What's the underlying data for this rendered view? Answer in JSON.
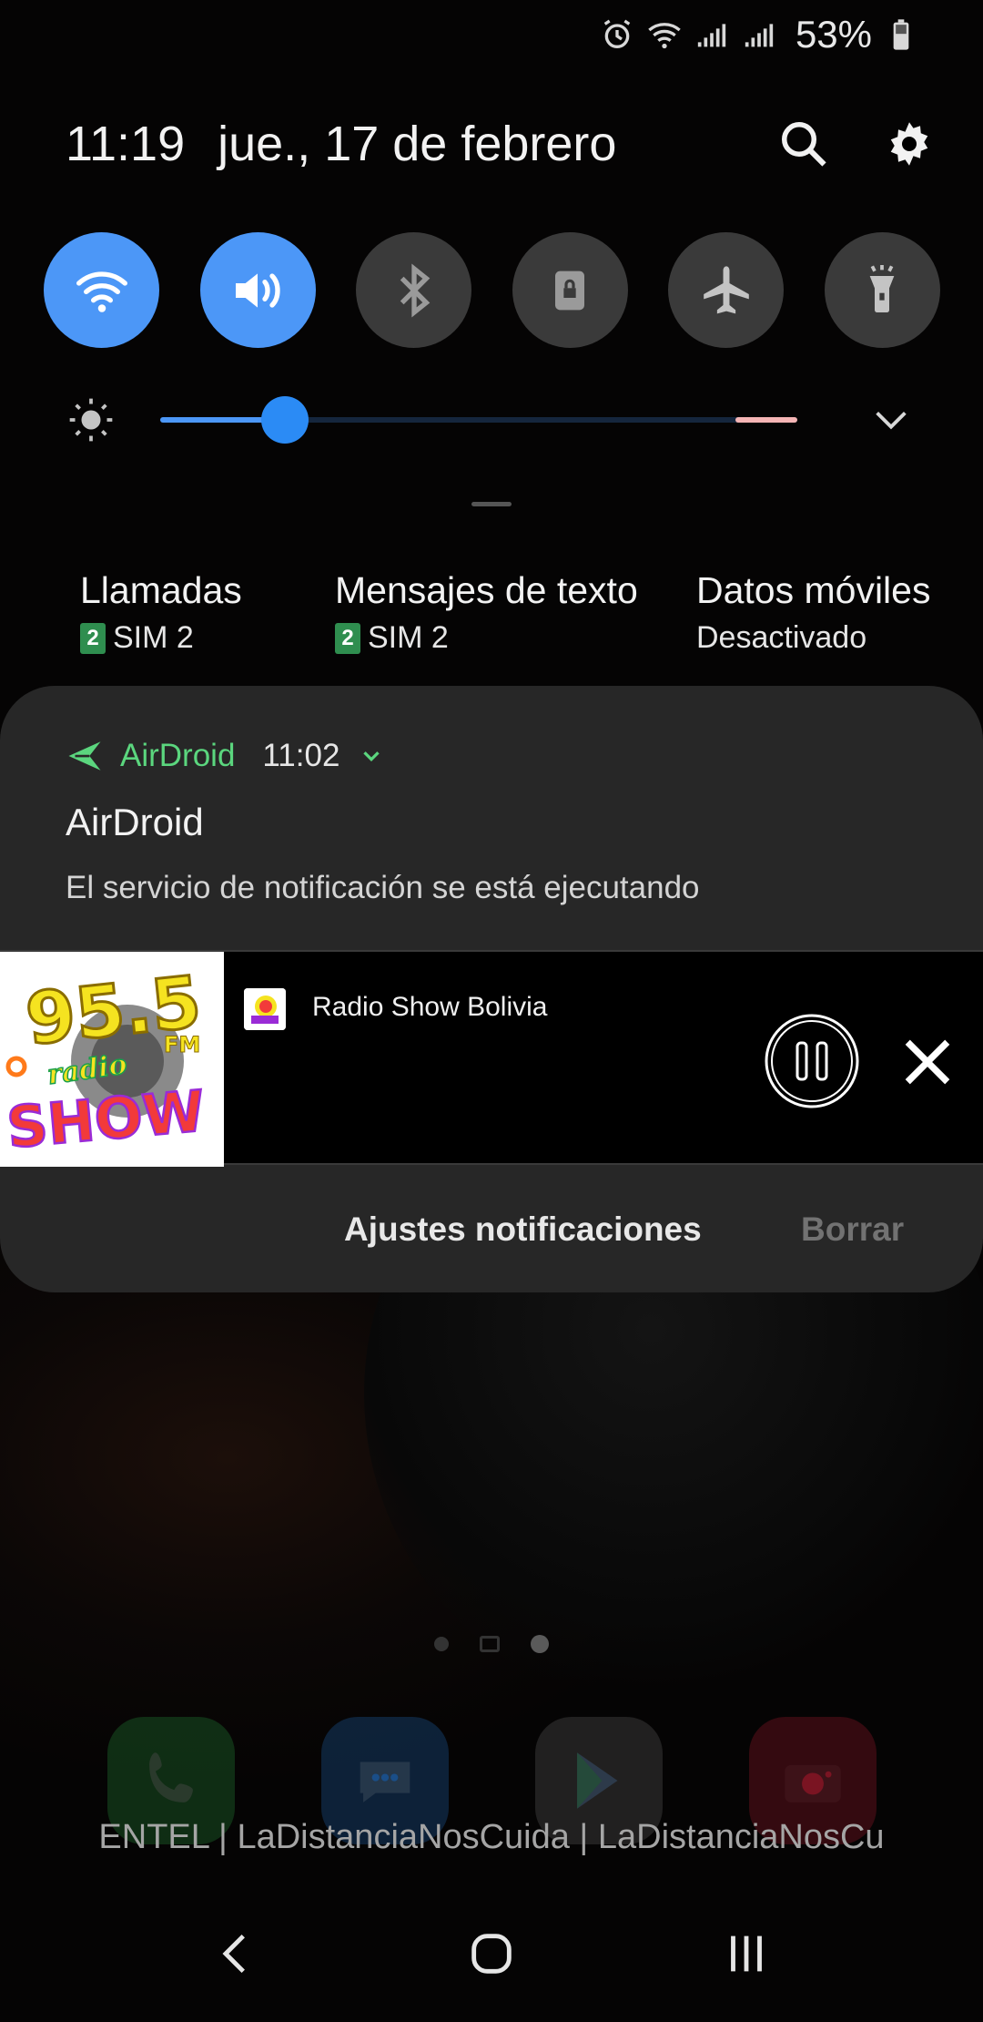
{
  "status_bar": {
    "battery_percent": "53%",
    "icons": [
      "alarm-icon",
      "wifi-icon",
      "signal-icon",
      "signal-icon",
      "battery-icon"
    ]
  },
  "header": {
    "time": "11:19",
    "date": "jue., 17 de febrero",
    "icons": [
      "search-icon",
      "gear-icon"
    ]
  },
  "quick_toggles": [
    {
      "name": "wifi-icon",
      "on": true
    },
    {
      "name": "sound-icon",
      "on": true
    },
    {
      "name": "bluetooth-icon",
      "on": false
    },
    {
      "name": "rotation-lock-icon",
      "on": false
    },
    {
      "name": "airplane-icon",
      "on": false
    },
    {
      "name": "flashlight-icon",
      "on": false
    }
  ],
  "brightness": {
    "level": 0.195,
    "colors": {
      "fill": "#4c97f7",
      "track": "#15263d",
      "warning": "#f5b5b5"
    }
  },
  "sim_info": [
    {
      "title": "Llamadas",
      "badge": "2",
      "value": "SIM 2"
    },
    {
      "title": "Mensajes de texto",
      "badge": "2",
      "value": "SIM 2"
    },
    {
      "title": "Datos móviles",
      "value": "Desactivado"
    }
  ],
  "notification": {
    "app": "AirDroid",
    "time": "11:02",
    "title": "AirDroid",
    "text": "El servicio de notificación se está ejecutando",
    "accent": "#5bd67e"
  },
  "media": {
    "title": "Radio Show Bolivia",
    "art_text": {
      "number": "95.5",
      "fm": "FM",
      "radio": "radio",
      "show": "SHOW"
    }
  },
  "notif_footer": {
    "settings": "Ajustes notificaciones",
    "clear": "Borrar"
  },
  "home": {
    "carrier_text": "ENTEL | LaDistanciaNosCuida | LaDistanciaNosCu",
    "dock": [
      {
        "name": "phone-icon",
        "color": "#1f6b2c"
      },
      {
        "name": "messages-icon",
        "color": "#1a4e88"
      },
      {
        "name": "play-store-icon",
        "color": "#4a4a4a"
      },
      {
        "name": "camera-icon",
        "color": "#7a1422"
      }
    ]
  }
}
